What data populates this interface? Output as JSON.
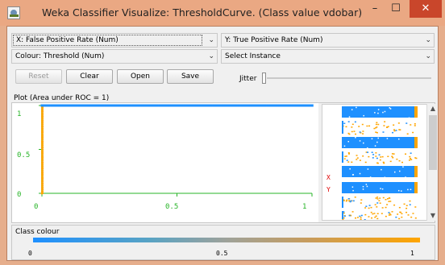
{
  "window": {
    "title": "Weka Classifier Visualize: ThresholdCurve. (Class value vdobar)",
    "minimize_glyph": "–",
    "maximize_glyph": "☐",
    "close_glyph": "✕"
  },
  "controls": {
    "x_axis": "X: False Positive Rate (Num)",
    "y_axis": "Y: True Positive Rate (Num)",
    "colour": "Colour: Threshold (Num)",
    "instance": "Select Instance",
    "dropdown_glyph": "⌄",
    "buttons": {
      "reset": "Reset",
      "clear": "Clear",
      "open": "Open",
      "save": "Save"
    },
    "jitter_label": "Jitter"
  },
  "plot": {
    "label": "Plot (Area under ROC = 1)",
    "y_ticks": [
      "1",
      "0.5",
      "0"
    ],
    "x_ticks": [
      "0",
      "0.5",
      "1"
    ],
    "side_x_label": "X",
    "side_y_label": "Y"
  },
  "class_colour": {
    "label": "Class colour",
    "ticks": [
      "0",
      "0.5",
      "1"
    ]
  },
  "chart_data": {
    "type": "line",
    "title": "Plot (Area under ROC = 1)",
    "xlabel": "False Positive Rate",
    "ylabel": "True Positive Rate",
    "xlim": [
      0,
      1
    ],
    "ylim": [
      0,
      1
    ],
    "series": [
      {
        "name": "",
        "x": [
          0,
          0,
          1
        ],
        "y": [
          0,
          1,
          1
        ]
      }
    ]
  },
  "colors": {
    "curve_top": "#1e90ff",
    "curve_left": "#ffa500",
    "axis": "#27b427",
    "close": "#c9462b"
  }
}
